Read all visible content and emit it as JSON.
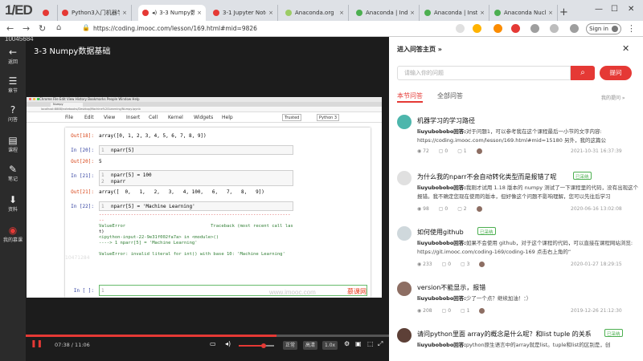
{
  "browser": {
    "corner_logo": "1/ED",
    "tabs": [
      {
        "label": "",
        "color": "#e53935"
      },
      {
        "label": "Python3入门机器学习",
        "color": "#e53935"
      },
      {
        "label": "3-3 Numpy数据",
        "color": "#e53935"
      },
      {
        "label": "3-1 Jupyter Note",
        "color": "#e53935"
      },
      {
        "label": "Anaconda.org",
        "color": "#9ccc65"
      },
      {
        "label": "Anaconda | Indivi",
        "color": "#4caf50"
      },
      {
        "label": "Anaconda | Install",
        "color": "#4caf50"
      },
      {
        "label": "Anaconda Nucleus",
        "color": "#4caf50"
      }
    ],
    "url": "https://coding.imooc.com/lesson/169.html#mid=9826",
    "sign_in": "Sign in"
  },
  "watermark": "10045684",
  "sidebar": {
    "items": [
      {
        "icon": "←",
        "label": "返回"
      },
      {
        "icon": "☰",
        "label": "章节"
      },
      {
        "icon": "?",
        "label": "问答"
      },
      {
        "icon": "▤",
        "label": "课程"
      },
      {
        "icon": "✎",
        "label": "笔记"
      },
      {
        "icon": "⬇",
        "label": "资料"
      },
      {
        "icon": "◉",
        "label": "我的慕课"
      }
    ]
  },
  "lesson_title": "3-3 Numpy数据基础",
  "notebook": {
    "mac_menu": "Chrome  File  Edit  View  History  Bookmarks  People  Window  Help",
    "tab_label": "Numpy",
    "inner_url": "localhost:8888/notebooks/Desktop/Machine%20Learning/Numpy.ipynb",
    "menu": [
      "File",
      "Edit",
      "View",
      "Insert",
      "Cell",
      "Kernel",
      "Widgets",
      "Help"
    ],
    "trusted": "Trusted",
    "kernel": "Python 3",
    "cells": {
      "out18_prompt": "Out[18]:",
      "out18_text": "array([0, 1, 2, 3, 4, 5, 6, 7, 8, 9])",
      "in20_prompt": "In [20]:",
      "in20_code": "nparr[5]",
      "out20_prompt": "Out[20]:",
      "out20_text": "5",
      "in21_prompt": "In [21]:",
      "in21_code1": "nparr[5] = 100",
      "in21_code2": "nparr",
      "out21_prompt": "Out[21]:",
      "out21_text": "array([  0,   1,   2,   3,   4, 100,   6,   7,   8,   9])",
      "in22_prompt": "In [22]:",
      "in22_code": "nparr[5] = 'Machine Learning'",
      "err_sep": "------------------------------------------------------------------------",
      "err_dash": "--",
      "err_line1": "ValueError                                Traceback (most recent call las",
      "err_line2": "t)",
      "err_line3": "<ipython-input-22-9e31f002fa7a> in <module>()",
      "err_line4": "----> 1 nparr[5] = 'Machine Learning'",
      "err_line5": "ValueError: invalid literal for int() with base 10: 'Machine Learning'",
      "in_empty_prompt": "In [ ]:",
      "faint_number": "10471284",
      "line_1": "1",
      "line_2": "2"
    },
    "imooc_wm": "www.imooc.com",
    "imooc_logo": "慕课网"
  },
  "player": {
    "time": "07:38 / 11:06",
    "progress": 0.69,
    "volume": 0.7,
    "buttons": [
      "正常",
      "高清",
      "1.0x"
    ],
    "accent": "#e53935"
  },
  "right_panel": {
    "header": "进入问答主页 »",
    "search_placeholder": "请输入你的问题",
    "ask_button": "提问",
    "tab_this": "本节问答",
    "tab_all": "全部问答",
    "my_questions": "我的提问 »",
    "questions": [
      {
        "title": "机器学习的学习路径",
        "badge": "",
        "author": "liuyubobobo回答:",
        "answer": "对于问题1，可以参考我在这个课程最后一小节的文字内容: https://coding.imooc.com/lesson/169.html#mid=15180 另外，我的这篇公",
        "views": "72",
        "comments": "0",
        "likes": "1",
        "date": "2021-10-31 16:37:39",
        "avatar_color": "#4db6ac"
      },
      {
        "title": "为什么我的nparr不会自动转化类型而是报错了呢",
        "badge": "已采纳",
        "author": "liuyubobobo回答:",
        "answer": "我刚才试用 1.18 版本的 numpy 测试了一下课程里的代码，没有出现这个报错。我不确定您现在使用的版本，但好像这个问题不影响理解，您可以先往后学习",
        "views": "98",
        "comments": "0",
        "likes": "2",
        "date": "2020-06-16 13:02:08",
        "avatar_color": "#e0e0e0"
      },
      {
        "title": "如何使用github",
        "badge": "已采纳",
        "author": "liuyubobobo回答:",
        "answer": "如果不会使用 github，对于这个课程的代码，可以直接在课程网站浏览: https://git.imooc.com/coding-169/coding-169 点击右上角的“",
        "views": "233",
        "comments": "0",
        "likes": "3",
        "date": "2020-01-27 18:29:15",
        "avatar_color": "#cfd8dc"
      },
      {
        "title": "version不能显示，报错",
        "badge": "",
        "author": "liuyubobobo回答:",
        "answer": "少了一个点？继续加油！：）",
        "views": "208",
        "comments": "0",
        "likes": "1",
        "date": "2019-12-26 21:12:30",
        "avatar_color": "#8d6e63"
      },
      {
        "title": "请问python里面 array的概念是什么呢？和list tuple 的关系",
        "badge": "已采纳",
        "author": "liuyubobobo回答:",
        "answer": "python原生语言中的array就是list。tuple和list的区别是，创",
        "views": "",
        "comments": "",
        "likes": "",
        "date": "",
        "avatar_color": "#5d4037"
      }
    ]
  }
}
